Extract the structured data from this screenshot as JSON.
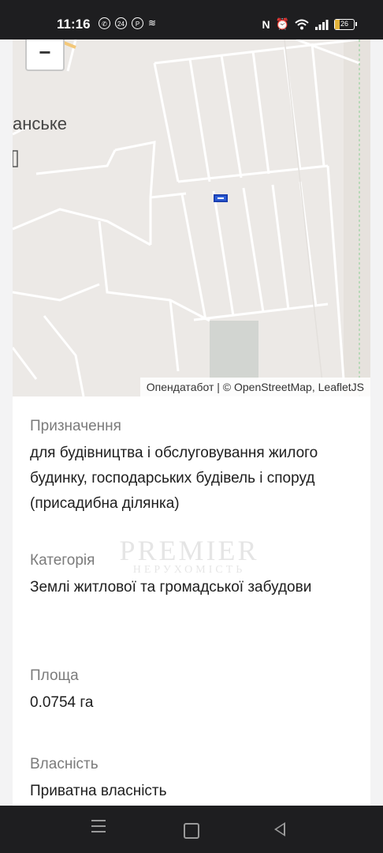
{
  "status_bar": {
    "time": "11:16",
    "left_icons": [
      "viber-icon",
      "24-icon",
      "parking-icon",
      "wavy-icon"
    ],
    "right_icons": [
      "nfc-icon",
      "alarm-icon",
      "wifi-icon",
      "signal-icon"
    ],
    "battery_level": "26",
    "nfc_label": "N"
  },
  "map": {
    "zoom_out_label": "−",
    "place_label": "анське",
    "attribution": "Опендатабот | © OpenStreetMap, LeafletJS",
    "marker_color": "#2e5ed8"
  },
  "details": {
    "purpose": {
      "label": "Призначення",
      "value": "для будівництва і обслуговування жилого будинку, господарських будівель і споруд (присадибна ділянка)"
    },
    "category": {
      "label": "Категорія",
      "value": "Землі житлової та громадської забудови"
    },
    "area": {
      "label": "Площа",
      "value": "0.0754 га"
    },
    "ownership": {
      "label": "Власність",
      "value": "Приватна власність"
    }
  },
  "watermark": {
    "main": "PREMIER",
    "sub": "НЕРУХОМІСТЬ"
  },
  "nav_bar": {
    "buttons": [
      "menu-icon",
      "home-icon",
      "back-icon"
    ]
  }
}
